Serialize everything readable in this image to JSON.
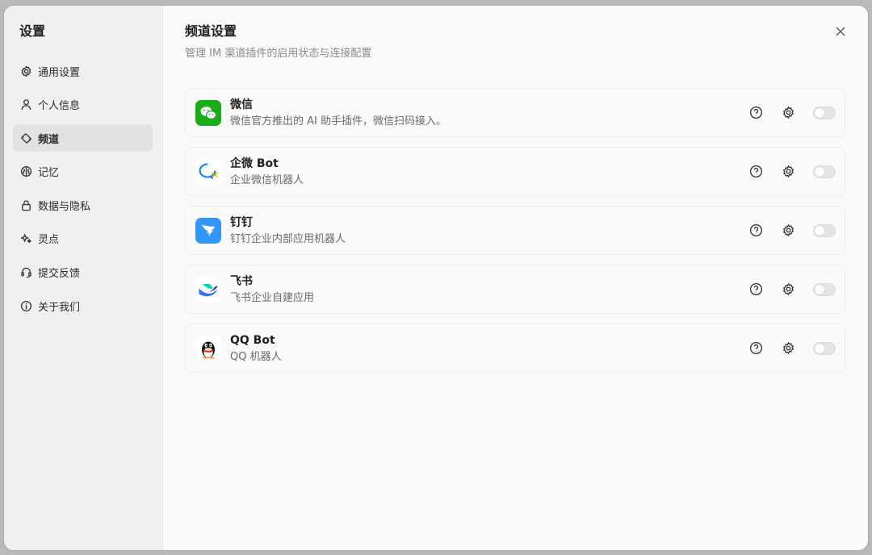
{
  "sidebar": {
    "title": "设置",
    "items": [
      {
        "label": "通用设置",
        "icon": "gear-icon"
      },
      {
        "label": "个人信息",
        "icon": "user-icon"
      },
      {
        "label": "频道",
        "icon": "channel-icon",
        "active": true
      },
      {
        "label": "记忆",
        "icon": "brain-icon"
      },
      {
        "label": "数据与隐私",
        "icon": "lock-icon"
      },
      {
        "label": "灵点",
        "icon": "sparkle-icon"
      },
      {
        "label": "提交反馈",
        "icon": "headset-icon"
      },
      {
        "label": "关于我们",
        "icon": "info-icon"
      }
    ]
  },
  "main": {
    "title": "频道设置",
    "subtitle": "管理 IM 渠道插件的启用状态与连接配置",
    "close_icon": "close-icon"
  },
  "channels": [
    {
      "name": "微信",
      "desc": "微信官方推出的 AI 助手插件，微信扫码接入。",
      "logo": "wechat-logo",
      "enabled": false
    },
    {
      "name": "企微 Bot",
      "desc": "企业微信机器人",
      "logo": "wecom-logo",
      "enabled": false
    },
    {
      "name": "钉钉",
      "desc": "钉钉企业内部应用机器人",
      "logo": "dingtalk-logo",
      "enabled": false
    },
    {
      "name": "飞书",
      "desc": "飞书企业自建应用",
      "logo": "feishu-logo",
      "enabled": false
    },
    {
      "name": "QQ Bot",
      "desc": "QQ 机器人",
      "logo": "qq-logo",
      "enabled": false
    }
  ],
  "colors": {
    "wechat": "#1aad19",
    "dingtalk": "#3296fa",
    "feishu_blue": "#3370ff",
    "feishu_teal": "#00d6b9",
    "wecom_blue": "#0082ef"
  }
}
